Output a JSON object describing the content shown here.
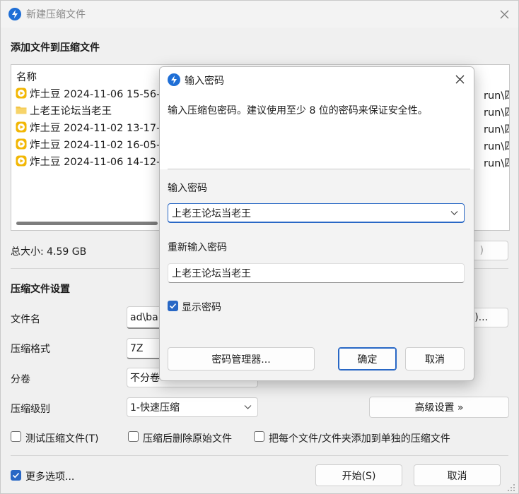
{
  "window": {
    "title": "新建压缩文件",
    "section_files": "添加文件到压缩文件",
    "list_header_name": "名称",
    "files": [
      {
        "name": "炸土豆 2024-11-06 15-56-",
        "type": "video"
      },
      {
        "name": "上老王论坛当老王",
        "type": "folder"
      },
      {
        "name": "炸土豆 2024-11-02 13-17-",
        "type": "video"
      },
      {
        "name": "炸土豆 2024-11-02 16-05-",
        "type": "video"
      },
      {
        "name": "炸土豆 2024-11-06 14-12-",
        "type": "video"
      }
    ],
    "right_fragments": [
      "run\\四/",
      "run\\四/",
      "run\\四/",
      "run\\四/",
      "run\\四/"
    ],
    "total_size": "总大小: 4.59 GB",
    "remove_btn_fragment": ")",
    "section_settings": "压缩文件设置",
    "filename_label": "文件名",
    "filename_value": "ad\\ba",
    "browse_btn_fragment": ")...",
    "format_label": "压缩格式",
    "format_value": "7Z",
    "split_label": "分卷",
    "split_value": "不分卷",
    "level_label": "压缩级别",
    "level_value": "1-快速压缩",
    "advanced_btn": "高级设置 »",
    "opt_test": "测试压缩文件(T)",
    "opt_delete": "压缩后删除原始文件",
    "opt_separate": "把每个文件/文件夹添加到单独的压缩文件",
    "more_options": "更多选项...",
    "start_btn": "开始(S)",
    "cancel_btn": "取消"
  },
  "dialog": {
    "title": "输入密码",
    "description": "输入压缩包密码。建议使用至少 8 位的密码来保证安全性。",
    "password_label": "输入密码",
    "password_value": "上老王论坛当老王",
    "repeat_label": "重新输入密码",
    "repeat_value": "上老王论坛当老王",
    "show_password": "显示密码",
    "show_password_checked": true,
    "manager_btn": "密码管理器...",
    "ok_btn": "确定",
    "cancel_btn": "取消"
  },
  "states": {
    "more_options_checked": true,
    "test_checked": false,
    "delete_checked": false,
    "separate_checked": false
  },
  "colors": {
    "accent": "#2867c5",
    "video_icon": "#f2b705",
    "folder_icon": "#f3c343"
  }
}
